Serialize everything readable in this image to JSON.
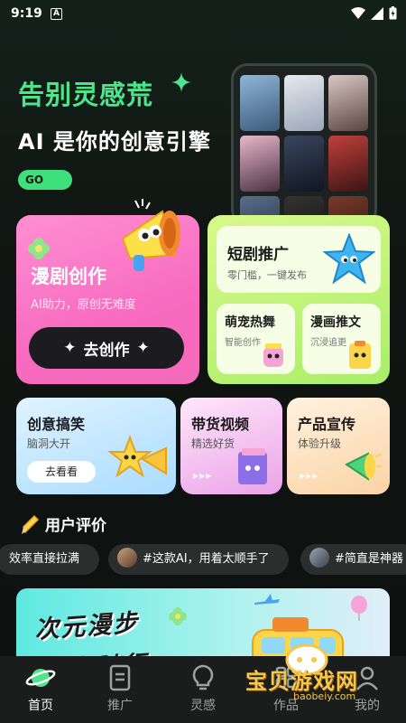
{
  "status_bar": {
    "time": "9:19"
  },
  "hero": {
    "title": "告别灵感荒",
    "subtitle": "AI 是你的创意引擎",
    "go_label": "GO >>>"
  },
  "manhua_card": {
    "title": "漫剧创作",
    "subtitle": "AI助力，原创无难度",
    "button": "去创作"
  },
  "duanju_card": {
    "title": "短剧推广",
    "subtitle": "零门槛，一键发布",
    "items": [
      {
        "title": "萌宠热舞",
        "subtitle": "智能创作"
      },
      {
        "title": "漫画推文",
        "subtitle": "沉浸追更"
      }
    ]
  },
  "mid_cards": [
    {
      "title": "创意搞笑",
      "subtitle": "脑洞大开",
      "button": "去看看",
      "color": "#bfe6ff"
    },
    {
      "title": "带货视频",
      "subtitle": "精选好货",
      "color": "#f4c6f0"
    },
    {
      "title": "产品宣传",
      "subtitle": "体验升级",
      "color": "#fde1bf"
    }
  ],
  "reviews": {
    "title": "用户评价",
    "chips": [
      {
        "text": "效率直接拉满"
      },
      {
        "text": "#这款AI，用着太顺手了"
      },
      {
        "text": "#简直是神器"
      }
    ]
  },
  "banner": {
    "line1": "次元漫步",
    "line2": "万象随行"
  },
  "tabs": [
    {
      "label": "首页",
      "icon": "planet-icon",
      "active": true
    },
    {
      "label": "推广",
      "icon": "document-icon"
    },
    {
      "label": "灵感",
      "icon": "lightbulb-icon"
    },
    {
      "label": "作品",
      "icon": "grid-icon"
    },
    {
      "label": "我的",
      "icon": "user-icon"
    }
  ],
  "watermark": {
    "text": "宝贝游戏网",
    "url": "baobeiy.com"
  },
  "colors": {
    "accent_green": "#3ee07c",
    "pink_card": "#f76bc0",
    "lime_card": "#a9ee6a"
  }
}
